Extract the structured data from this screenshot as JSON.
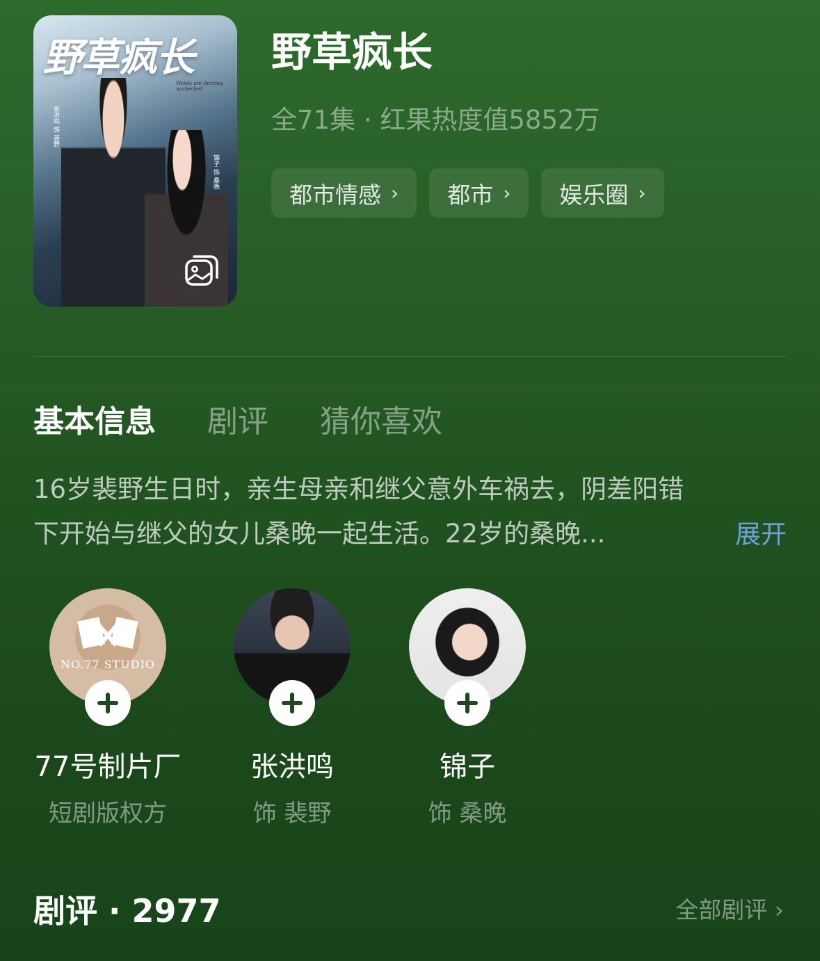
{
  "poster": {
    "title_art": "野草疯长",
    "subtitle_en": "Weeds are thriving unchecked",
    "credit_left": "张洪鸣 饰 裴野",
    "credit_right": "锦子 饰 桑晚",
    "gallery_icon": "gallery-icon"
  },
  "drama": {
    "title": "野草疯长",
    "meta": "全71集 · 红果热度值5852万",
    "tags": [
      {
        "label": "都市情感",
        "icon": "chevron-right-icon"
      },
      {
        "label": "都市",
        "icon": "chevron-right-icon"
      },
      {
        "label": "娱乐圈",
        "icon": "chevron-right-icon"
      }
    ]
  },
  "tabs": [
    {
      "label": "基本信息",
      "active": true
    },
    {
      "label": "剧评",
      "active": false
    },
    {
      "label": "猜你喜欢",
      "active": false
    }
  ],
  "description": {
    "line1": "16岁裴野生日时，亲生母亲和继父意外车祸去，阴差阳错",
    "line2": "下开始与继父的女儿桑晚一起生活。22岁的桑晚...",
    "expand_label": "展开"
  },
  "people": [
    {
      "name": "77号制片厂",
      "role": "短剧版权方",
      "avatar_text": "NO.77 STUDIO",
      "follow_icon": "plus-icon"
    },
    {
      "name": "张洪鸣",
      "role": "饰 裴野",
      "follow_icon": "plus-icon"
    },
    {
      "name": "锦子",
      "role": "饰 桑晚",
      "follow_icon": "plus-icon"
    }
  ],
  "reviews": {
    "title": "剧评 · 2977",
    "all_label": "全部剧评",
    "all_icon": "chevron-right-icon"
  },
  "colors": {
    "background_top": "#2e6a2c",
    "background_bottom": "#184419",
    "expand_link": "#6fa1d8"
  }
}
